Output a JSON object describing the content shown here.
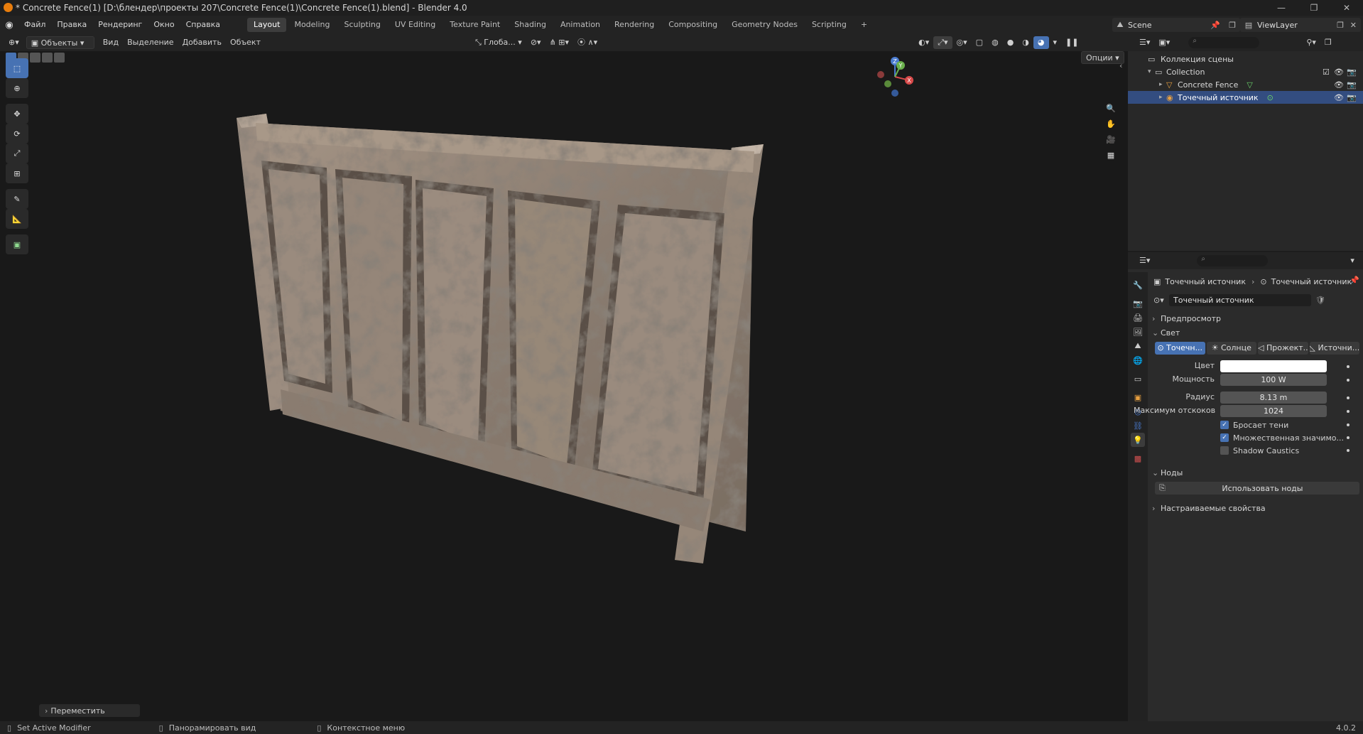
{
  "titlebar": {
    "title": "* Concrete Fence(1) [D:\\блендер\\проекты 207\\Concrete Fence(1)\\Concrete Fence(1).blend] - Blender 4.0"
  },
  "menu": [
    "Файл",
    "Правка",
    "Рендеринг",
    "Окно",
    "Справка"
  ],
  "workspaces": [
    "Layout",
    "Modeling",
    "Sculpting",
    "UV Editing",
    "Texture Paint",
    "Shading",
    "Animation",
    "Rendering",
    "Compositing",
    "Geometry Nodes",
    "Scripting"
  ],
  "workspace_add": "+",
  "scene": {
    "name": "Scene",
    "view_layer": "ViewLayer"
  },
  "viewport": {
    "mode": "Объекты",
    "menus": [
      "Вид",
      "Выделение",
      "Добавить",
      "Объект"
    ],
    "orientation": "Глоба...",
    "options": "Опции",
    "last_op": "Переместить",
    "gizmo": {
      "x": "X",
      "y": "Y",
      "z": "Z"
    }
  },
  "outliner": {
    "root": "Коллекция сцены",
    "collection": "Collection",
    "items": [
      "Concrete Fence",
      "Точечный источник"
    ]
  },
  "properties": {
    "breadcrumb": [
      "Точечный источник",
      "Точечный источник"
    ],
    "datablock": "Точечный источник",
    "panels": {
      "preview": "Предпросмотр",
      "light": "Свет",
      "nodes": "Ноды",
      "custom": "Настраиваемые свойства"
    },
    "light_types": [
      "Точечн...",
      "Солнце",
      "Прожект...",
      "Источни..."
    ],
    "fields": [
      {
        "label": "Цвет",
        "value": ""
      },
      {
        "label": "Мощность",
        "value": "100 W"
      },
      {
        "label": "Радиус",
        "value": "8.13 m"
      },
      {
        "label": "Максимум отскоков",
        "value": "1024"
      }
    ],
    "checks": [
      {
        "label": "Бросает тени",
        "checked": true
      },
      {
        "label": "Множественная значимо...",
        "checked": true
      },
      {
        "label": "Shadow Caustics",
        "checked": false
      }
    ],
    "use_nodes": "Использовать ноды"
  },
  "statusbar": {
    "items": [
      "Set Active Modifier",
      "Панорамировать вид",
      "Контекстное меню"
    ],
    "version": "4.0.2"
  },
  "colors": {
    "accent": "#4772b3",
    "selected_row": "#334d80",
    "fence": "#8b7d70"
  }
}
